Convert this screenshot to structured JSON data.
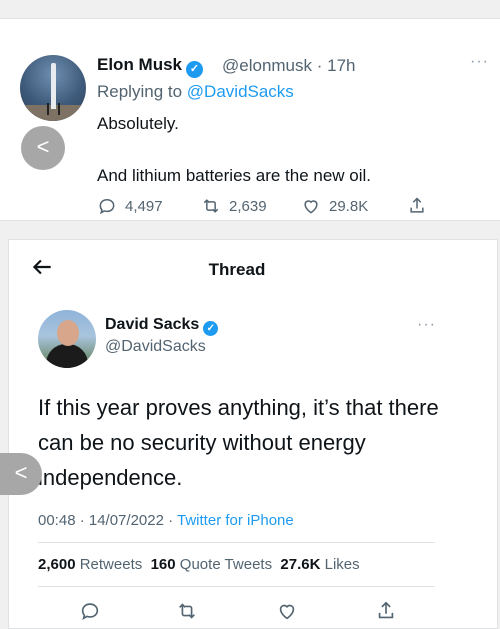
{
  "reply_tweet": {
    "author_name": "Elon Musk",
    "author_handle": "@elonmusk",
    "time": "· 17h",
    "replying_prefix": "Replying to",
    "replying_to": "@DavidSacks",
    "text_line1": "Absolutely.",
    "text_line2": "And lithium batteries are the new oil.",
    "reply_count": "4,497",
    "retweet_count": "2,639",
    "like_count": "29.8K",
    "more": "···"
  },
  "thread": {
    "title": "Thread",
    "author_name": "David Sacks",
    "author_handle": "@DavidSacks",
    "more": "···",
    "text": "If this year proves anything, it’s that there can be no security without energy independence.",
    "time_date": "00:48 · 14/07/2022 ·",
    "source": "Twitter for iPhone",
    "retweets_count": "2,600",
    "retweets_label": "Retweets",
    "quote_count": "160",
    "quote_label": "Quote Tweets",
    "likes_count": "27.6K",
    "likes_label": "Likes"
  },
  "nav": {
    "prev_symbol": "<"
  },
  "icons": [
    "reply-icon",
    "retweet-icon",
    "like-icon",
    "share-icon",
    "back-arrow-icon",
    "verified-badge-icon",
    "more-icon"
  ],
  "colors": {
    "accent": "#1d9bf0",
    "secondary_text": "#536471",
    "primary_text": "#0f1419"
  }
}
